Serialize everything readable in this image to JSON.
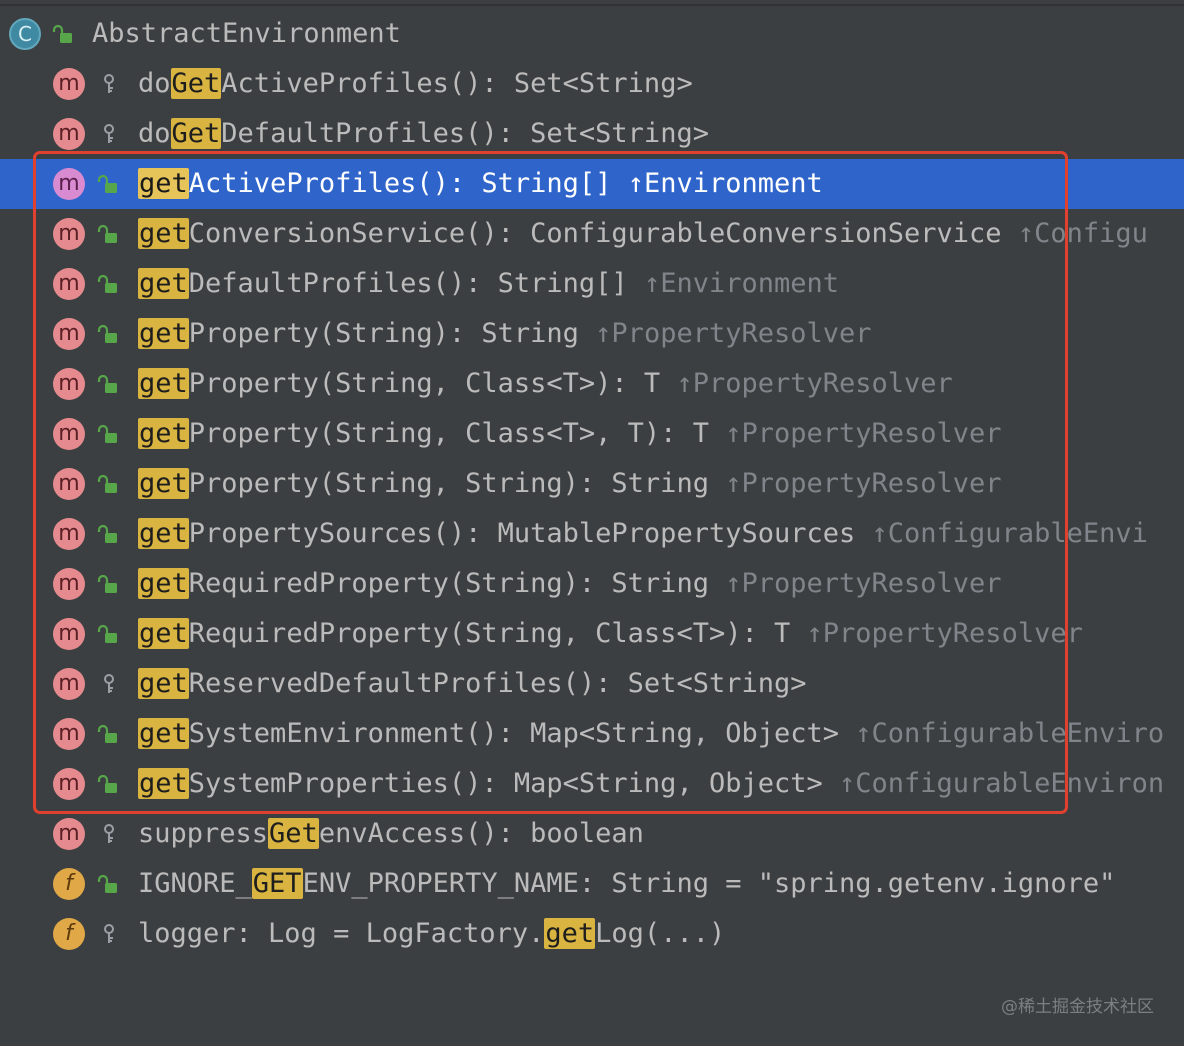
{
  "structure": {
    "class_name": "AbstractEnvironment",
    "class_icon_letter": "C"
  },
  "items": [
    {
      "kind": "method",
      "vis": "key",
      "pre": "do",
      "hl": "Get",
      "post": "ActiveProfiles(): Set<String>",
      "origin": ""
    },
    {
      "kind": "method",
      "vis": "key",
      "pre": "do",
      "hl": "Get",
      "post": "DefaultProfiles(): Set<String>",
      "origin": ""
    },
    {
      "kind": "method",
      "vis": "lock-open",
      "pre": "",
      "hl": "get",
      "post": "ActiveProfiles(): String[] ",
      "origin": "↑Environment",
      "selected": true
    },
    {
      "kind": "method",
      "vis": "lock-open",
      "pre": "",
      "hl": "get",
      "post": "ConversionService(): ConfigurableConversionService ",
      "origin": "↑Configu"
    },
    {
      "kind": "method",
      "vis": "lock-open",
      "pre": "",
      "hl": "get",
      "post": "DefaultProfiles(): String[] ",
      "origin": "↑Environment"
    },
    {
      "kind": "method",
      "vis": "lock-open",
      "pre": "",
      "hl": "get",
      "post": "Property(String): String ",
      "origin": "↑PropertyResolver"
    },
    {
      "kind": "method",
      "vis": "lock-open",
      "pre": "",
      "hl": "get",
      "post": "Property(String, Class<T>): T ",
      "origin": "↑PropertyResolver"
    },
    {
      "kind": "method",
      "vis": "lock-open",
      "pre": "",
      "hl": "get",
      "post": "Property(String, Class<T>, T): T ",
      "origin": "↑PropertyResolver"
    },
    {
      "kind": "method",
      "vis": "lock-open",
      "pre": "",
      "hl": "get",
      "post": "Property(String, String): String ",
      "origin": "↑PropertyResolver"
    },
    {
      "kind": "method",
      "vis": "lock-open",
      "pre": "",
      "hl": "get",
      "post": "PropertySources(): MutablePropertySources ",
      "origin": "↑ConfigurableEnvi"
    },
    {
      "kind": "method",
      "vis": "lock-open",
      "pre": "",
      "hl": "get",
      "post": "RequiredProperty(String): String ",
      "origin": "↑PropertyResolver"
    },
    {
      "kind": "method",
      "vis": "lock-open",
      "pre": "",
      "hl": "get",
      "post": "RequiredProperty(String, Class<T>): T ",
      "origin": "↑PropertyResolver"
    },
    {
      "kind": "method",
      "vis": "key",
      "pre": "",
      "hl": "get",
      "post": "ReservedDefaultProfiles(): Set<String>",
      "origin": ""
    },
    {
      "kind": "method",
      "vis": "lock-open",
      "pre": "",
      "hl": "get",
      "post": "SystemEnvironment(): Map<String, Object> ",
      "origin": "↑ConfigurableEnviro"
    },
    {
      "kind": "method",
      "vis": "lock-open",
      "pre": "",
      "hl": "get",
      "post": "SystemProperties(): Map<String, Object> ",
      "origin": "↑ConfigurableEnviron"
    },
    {
      "kind": "method",
      "vis": "key",
      "pre": "suppress",
      "hl": "Get",
      "post": "envAccess(): boolean",
      "origin": ""
    },
    {
      "kind": "field",
      "vis": "lock-open",
      "pre": "IGNORE_",
      "hl": "GET",
      "post": "ENV_PROPERTY_NAME: String = \"spring.getenv.ignore\"",
      "origin": ""
    },
    {
      "kind": "field",
      "vis": "key",
      "pre": "logger: Log = LogFactory.",
      "hl": "get",
      "post": "Log(...)",
      "origin": ""
    }
  ],
  "icons": {
    "method_letter": "m",
    "field_letter": "f"
  },
  "watermark": "@稀土掘金技术社区"
}
